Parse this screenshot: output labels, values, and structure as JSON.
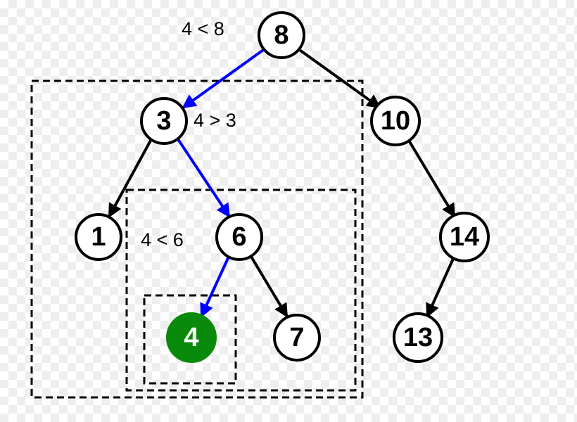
{
  "diagram": {
    "nodes": {
      "root": {
        "value": "8",
        "highlight": false
      },
      "n3": {
        "value": "3",
        "highlight": false
      },
      "n10": {
        "value": "10",
        "highlight": false
      },
      "n1": {
        "value": "1",
        "highlight": false
      },
      "n6": {
        "value": "6",
        "highlight": false
      },
      "n14": {
        "value": "14",
        "highlight": false
      },
      "n4": {
        "value": "4",
        "highlight": true
      },
      "n7": {
        "value": "7",
        "highlight": false
      },
      "n13": {
        "value": "13",
        "highlight": false
      }
    },
    "annotations": {
      "cmp_root": "4 < 8",
      "cmp_n3": "4 > 3",
      "cmp_n6": "4 < 6"
    },
    "edges": [
      {
        "from": "root",
        "to": "n3",
        "path": true
      },
      {
        "from": "root",
        "to": "n10",
        "path": false
      },
      {
        "from": "n3",
        "to": "n1",
        "path": false
      },
      {
        "from": "n3",
        "to": "n6",
        "path": true
      },
      {
        "from": "n6",
        "to": "n4",
        "path": true
      },
      {
        "from": "n6",
        "to": "n7",
        "path": false
      },
      {
        "from": "n10",
        "to": "n14",
        "path": false
      },
      {
        "from": "n14",
        "to": "n13",
        "path": false
      }
    ],
    "search_target": 4,
    "tree_structure": "binary-search-tree"
  }
}
